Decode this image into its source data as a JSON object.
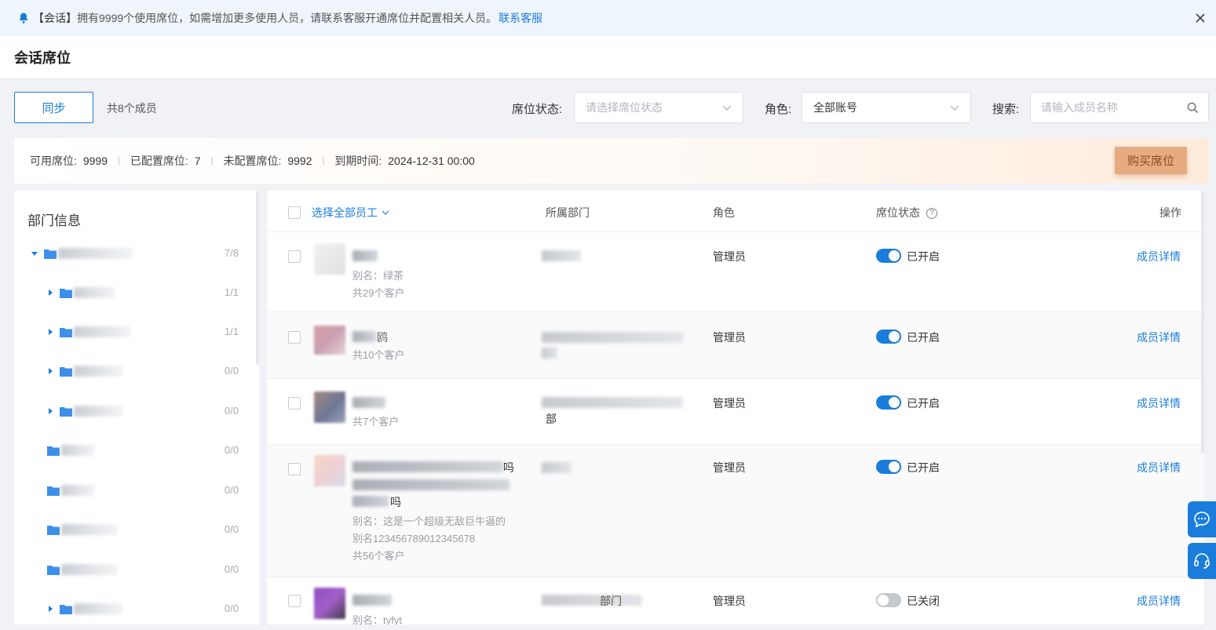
{
  "notice": {
    "tag": "【会话】",
    "message": "拥有9999个使用席位，如需增加更多使用人员，请联系客服开通席位并配置相关人员。",
    "link": "联系客服"
  },
  "header": {
    "title": "会话席位"
  },
  "toolbar": {
    "sync_label": "同步",
    "member_count": "共8个成员",
    "seat_status_label": "席位状态:",
    "seat_status_placeholder": "请选择席位状态",
    "role_label": "角色:",
    "role_value": "全部账号",
    "search_label": "搜索:",
    "search_placeholder": "请输入成员名称"
  },
  "seats": {
    "available_label": "可用席位:",
    "available_value": "9999",
    "configured_label": "已配置席位:",
    "configured_value": "7",
    "unconfigured_label": "未配置席位:",
    "unconfigured_value": "9992",
    "expire_label": "到期时间:",
    "expire_value": "2024-12-31 00:00",
    "buy_label": "购买席位"
  },
  "dept": {
    "title": "部门信息",
    "counts": [
      "7/8",
      "1/1",
      "1/1",
      "0/0",
      "0/0",
      "0/0",
      "0/0",
      "0/0",
      "0/0",
      "0/0"
    ]
  },
  "table": {
    "headers": {
      "select_all": "选择全部员工",
      "department": "所属部门",
      "role": "角色",
      "status": "席位状态",
      "action": "操作"
    },
    "rows": [
      {
        "alias": "别名：绿茶",
        "customers": "共29个客户",
        "role": "管理员",
        "status": "已开启",
        "enabled": true,
        "action": "成员详情"
      },
      {
        "name_suffix": "鸥",
        "customers": "共10个客户",
        "role": "管理员",
        "status": "已开启",
        "enabled": true,
        "action": "成员详情"
      },
      {
        "customers": "共7个客户",
        "dept_suffix": "部",
        "role": "管理员",
        "status": "已开启",
        "enabled": true,
        "action": "成员详情"
      },
      {
        "name_suffix": "吗",
        "name_suffix2": "吗",
        "alias": "别名：这是一个超级无敌巨牛逼的",
        "alias2": "别名123456789012345678",
        "customers": "共56个客户",
        "role": "管理员",
        "status": "已开启",
        "enabled": true,
        "action": "成员详情"
      },
      {
        "alias": "别名：tyfyt",
        "dept_suffix": "部门",
        "role": "管理员",
        "status": "已关闭",
        "enabled": false,
        "action": "成员详情"
      }
    ]
  },
  "colors": {
    "primary": "#1a7ddb",
    "buy_button": "#e6ab80",
    "notice_bg": "#eef5fd"
  },
  "icons": [
    "bell-icon",
    "close-icon",
    "chevron-down-icon",
    "search-icon",
    "folder-icon",
    "caret-icon",
    "help-icon",
    "chat-icon",
    "headset-icon"
  ]
}
